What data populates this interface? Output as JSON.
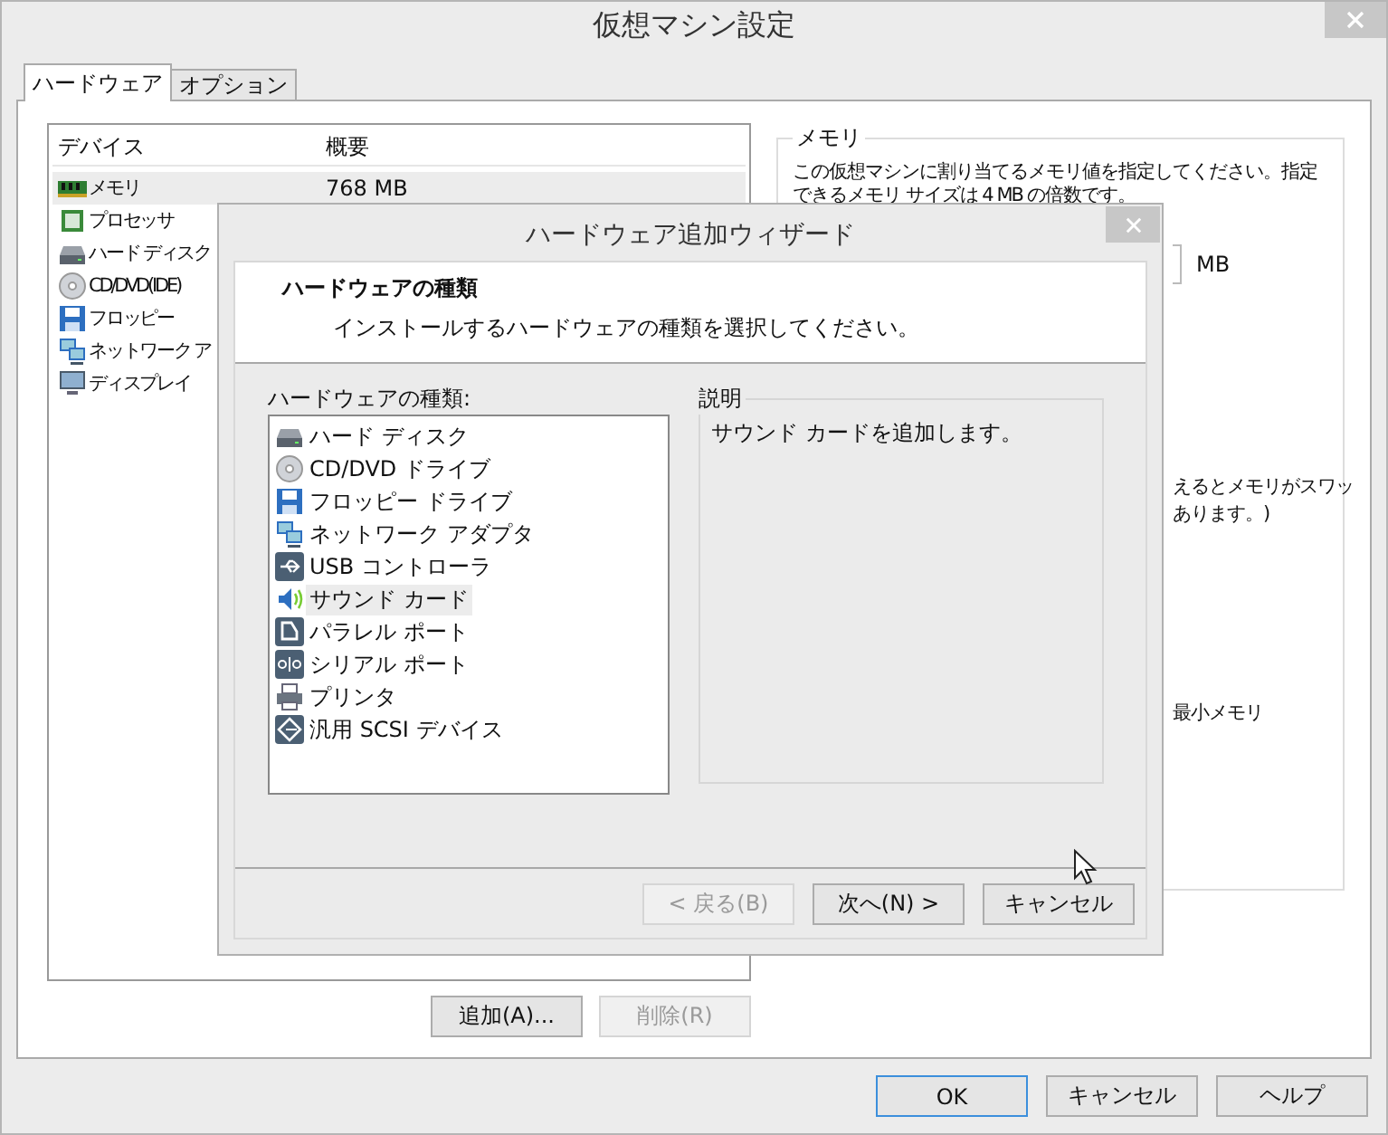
{
  "window": {
    "title": "仮想マシン設定"
  },
  "tabs": [
    {
      "label": "ハードウェア",
      "selected": true
    },
    {
      "label": "オプション",
      "selected": false
    }
  ],
  "device_list": {
    "columns": [
      "デバイス",
      "概要"
    ],
    "rows": [
      {
        "device": "メモリ",
        "summary": "768 MB",
        "kind": "memory",
        "selected": true
      },
      {
        "device": "プロセッサ",
        "kind": "cpu",
        "selected": false
      },
      {
        "device": "ハード ディスク",
        "kind": "disk",
        "selected": false
      },
      {
        "device": "CD/DVD(IDE)",
        "kind": "cd",
        "selected": false
      },
      {
        "device": "フロッピー",
        "kind": "floppy",
        "selected": false
      },
      {
        "device": "ネットワーク ア",
        "kind": "network",
        "selected": false
      },
      {
        "device": "ディスプレイ",
        "kind": "display",
        "selected": false
      }
    ]
  },
  "device_buttons": [
    {
      "label": "追加(A)...",
      "disabled": false
    },
    {
      "label": "削除(R)",
      "disabled": true
    }
  ],
  "memory_panel": {
    "legend": "メモリ",
    "description": [
      "この仮想マシンに割り当てるメモリ値を指定してください。指定",
      "できるメモリ サイズは 4 MB の倍数です。"
    ],
    "unit": "MB",
    "fragments": [
      "えるとメモリがスワッ",
      "あります。)",
      "最小メモリ"
    ]
  },
  "dialog_buttons": [
    {
      "label": "OK",
      "default": true
    },
    {
      "label": "キャンセル",
      "default": false
    },
    {
      "label": "ヘルプ",
      "default": false
    }
  ],
  "wizard": {
    "title": "ハードウェア追加ウィザード",
    "heading": "ハードウェアの種類",
    "subheading": "インストールするハードウェアの種類を選択してください。",
    "list_label": "ハードウェアの種類:",
    "hardware_types": [
      {
        "label": "ハード ディスク",
        "kind": "disk",
        "selected": false
      },
      {
        "label": "CD/DVD ドライブ",
        "kind": "cd",
        "selected": false
      },
      {
        "label": "フロッピー ドライブ",
        "kind": "floppy",
        "selected": false
      },
      {
        "label": "ネットワーク アダプタ",
        "kind": "network",
        "selected": false
      },
      {
        "label": "USB コントローラ",
        "kind": "usb",
        "selected": false
      },
      {
        "label": "サウンド カード",
        "kind": "sound",
        "selected": true
      },
      {
        "label": "パラレル ポート",
        "kind": "parallel",
        "selected": false
      },
      {
        "label": "シリアル ポート",
        "kind": "serial",
        "selected": false
      },
      {
        "label": "プリンタ",
        "kind": "printer",
        "selected": false
      },
      {
        "label": "汎用 SCSI デバイス",
        "kind": "scsi",
        "selected": false
      }
    ],
    "description_legend": "説明",
    "description": "サウンド カードを追加します。",
    "buttons": [
      {
        "label": "< 戻る(B)",
        "disabled": true
      },
      {
        "label": "次へ(N) >",
        "disabled": false
      },
      {
        "label": "キャンセル",
        "disabled": false
      }
    ]
  }
}
